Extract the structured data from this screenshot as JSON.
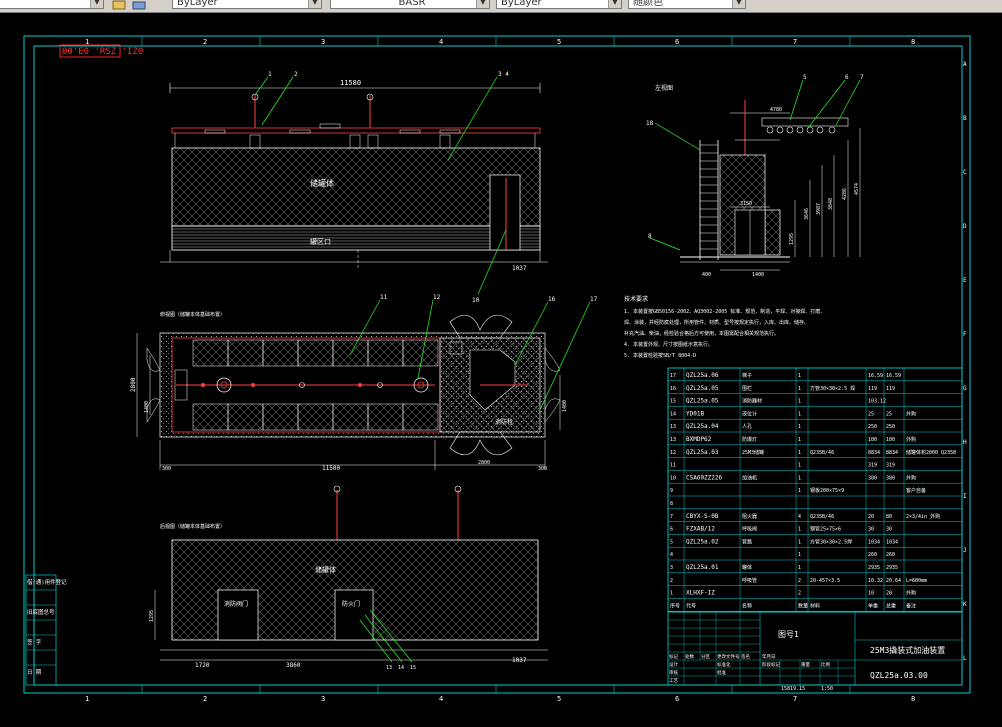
{
  "toolbar": {
    "linetype_value": "ByLayer",
    "linestyle_value": "BASR",
    "lineweight_value": "ByLayer",
    "color_value": "随颜色"
  },
  "drawing": {
    "stamp": "00'E0 'RSZ 'IZ0",
    "grid_numbers": [
      "1",
      "2",
      "3",
      "4",
      "5",
      "6",
      "7",
      "8"
    ],
    "grid_letters": [
      "A",
      "B",
      "C",
      "D",
      "E",
      "F",
      "G",
      "H",
      "I",
      "J",
      "K",
      "L"
    ],
    "front_view": {
      "width_dim": "11580",
      "right_dim": "1037",
      "callouts": [
        "1",
        "2",
        "3 4",
        "10"
      ],
      "label_upper": "储罐体",
      "label_lower": "罐区口"
    },
    "side_view": {
      "title": "左视图",
      "dims": [
        "4780",
        "3150",
        "1400",
        "400",
        "1295",
        "3646",
        "3987",
        "3848",
        "4286",
        "4574"
      ],
      "callouts": [
        "5",
        "6",
        "7",
        "8",
        "18"
      ]
    },
    "plan_view": {
      "title": "俯视图（储罐本体基础布置）",
      "dims": [
        "2800",
        "1400",
        "11500",
        "2800",
        "300",
        "300",
        "1400"
      ],
      "callouts": [
        "11",
        "12",
        "16",
        "17"
      ],
      "label": "消防栓"
    },
    "rear_view": {
      "title": "后视图（储罐本体基础布置）",
      "label_main": "储罐体",
      "label_door_left": "消防阀门",
      "label_door_right": "防火门",
      "dims": [
        "1295",
        "1720",
        "3860",
        "1037"
      ],
      "callouts": [
        "13",
        "14",
        "15"
      ]
    },
    "notes": {
      "title": "技术要求",
      "lines": [
        "1. 本装置按GB50156-2002、AQ3002-2005 标准、规范、制造，平焊、对接焊、打磨、",
        "焊、涂装，并经防腐处理，所用管件、材质、型号按规定执行，入库、出库、储存、",
        "补充汽油、柴油，经检验合格后方可使用，本图需配合相关规范执行。",
        "4. 本装置外观、尺寸按图纸示意执行。",
        "5. 本装置检验按SB/T 8004-D"
      ]
    },
    "bom": {
      "headers": [
        "序号",
        "代号",
        "名称",
        "数量",
        "材料",
        "单重",
        "总重",
        "备注"
      ],
      "rows": [
        {
          "no": "17",
          "code": "QZL25a.06",
          "name": "梯子",
          "qty": "1",
          "material": "",
          "unit": "16.59",
          "total": "16.59",
          "note": ""
        },
        {
          "no": "16",
          "code": "QZL25a.05",
          "name": "围栏",
          "qty": "1",
          "material": "方管30×30×2.5 焊",
          "unit": "119",
          "total": "119",
          "note": ""
        },
        {
          "no": "15",
          "code": "QZL25a.05",
          "name": "消防器材",
          "qty": "1",
          "material": "",
          "unit": "103.12",
          "total": "",
          "note": ""
        },
        {
          "no": "14",
          "code": "YD01B",
          "name": "液位计",
          "qty": "1",
          "material": "",
          "unit": "25",
          "total": "25",
          "note": "外购"
        },
        {
          "no": "13",
          "code": "QZL25a.04",
          "name": "人孔",
          "qty": "1",
          "material": "",
          "unit": "250",
          "total": "250",
          "note": ""
        },
        {
          "no": "13",
          "code": "BXMDP62",
          "name": "防爆灯",
          "qty": "1",
          "material": "",
          "unit": "100",
          "total": "100",
          "note": "外购"
        },
        {
          "no": "12",
          "code": "QZL25a.03",
          "name": "25M3储罐",
          "qty": "1",
          "material": "Q235B/46",
          "unit": "8834",
          "total": "8834",
          "note": "储罐体积2000 Q235B"
        },
        {
          "no": "11",
          "code": "",
          "name": "",
          "qty": "1",
          "material": "",
          "unit": "319",
          "total": "319",
          "note": ""
        },
        {
          "no": "10",
          "code": "CSA60ZZ226",
          "name": "加油机",
          "qty": "1",
          "material": "",
          "unit": "380",
          "total": "380",
          "note": "外购"
        },
        {
          "no": "9",
          "code": "",
          "name": "",
          "qty": "1",
          "material": "钢板200×75×9",
          "unit": "",
          "total": "",
          "note": "客户自备"
        },
        {
          "no": "8",
          "code": "",
          "name": "",
          "qty": "",
          "material": "",
          "unit": "",
          "total": "",
          "note": ""
        },
        {
          "no": "7",
          "code": "CBYX-S-0B",
          "name": "阻火器",
          "qty": "4",
          "material": "Q235B/46",
          "unit": "20",
          "total": "80",
          "note": "2×3/4in 外购"
        },
        {
          "no": "6",
          "code": "FZXAB/12",
          "name": "呼吸阀",
          "qty": "1",
          "material": "钢管25×75×6",
          "unit": "30",
          "total": "30",
          "note": ""
        },
        {
          "no": "5",
          "code": "QZL25a.02",
          "name": "管路",
          "qty": "1",
          "material": "方管30×30×2.5焊",
          "unit": "1034",
          "total": "1034",
          "note": ""
        },
        {
          "no": "4",
          "code": "",
          "name": "",
          "qty": "1",
          "material": "",
          "unit": "260",
          "total": "260",
          "note": ""
        },
        {
          "no": "3",
          "code": "QZL25a.01",
          "name": "罐体",
          "qty": "1",
          "material": "",
          "unit": "2935",
          "total": "2935",
          "note": ""
        },
        {
          "no": "2",
          "code": "",
          "name": "呼吸管",
          "qty": "2",
          "material": "20-457×3.5",
          "unit": "10.32",
          "total": "20.64",
          "note": "L=600mm"
        },
        {
          "no": "1",
          "code": "XLHXF-IZ",
          "name": "",
          "qty": "2",
          "material": "",
          "unit": "10",
          "total": "20",
          "note": "外购"
        }
      ]
    },
    "title_block": {
      "name": "25M3撬装式加油装置",
      "drawing_no": "QZL25a.03.00",
      "scale_label": "图号1",
      "sheet": "1:50",
      "weight": "15819.15",
      "header_cells": [
        "标记",
        "处数",
        "分区",
        "更改文件号",
        "签名",
        "年月日"
      ],
      "row_labels": [
        "设计",
        "审核",
        "工艺"
      ],
      "extra_labels": [
        "标准化",
        "批准",
        "阶段标记",
        "重量",
        "比例"
      ]
    },
    "left_strip": {
      "labels": [
        "借(通)用件登记",
        "旧底图总号",
        "签 字",
        "日 期"
      ]
    }
  }
}
